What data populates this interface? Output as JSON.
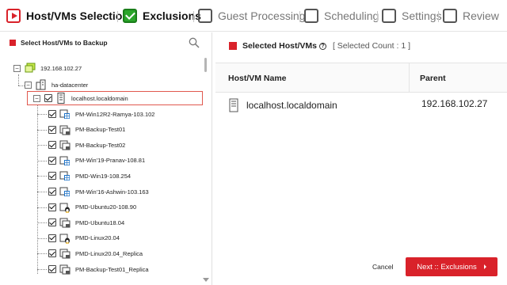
{
  "wizard": {
    "steps": [
      {
        "label": "Host/VMs Selection",
        "state": "active"
      },
      {
        "label": "Exclusions",
        "state": "done"
      },
      {
        "label": "Guest Processing",
        "state": "pending"
      },
      {
        "label": "Scheduling",
        "state": "pending"
      },
      {
        "label": "Settings",
        "state": "pending"
      },
      {
        "label": "Review",
        "state": "pending"
      }
    ]
  },
  "left_panel": {
    "title": "Select Host/VMs to Backup",
    "tree": {
      "root": {
        "label": "192.168.102.27",
        "icon": "host-cluster-icon"
      },
      "datacenter": {
        "label": "ha-datacenter",
        "icon": "datacenter-icon"
      },
      "host": {
        "label": "localhost.localdomain",
        "icon": "server-icon"
      },
      "vms": [
        {
          "label": "PM-Win12R2-Ramya-103.102",
          "icon": "windows-vm-icon"
        },
        {
          "label": "PM-Backup-Test01",
          "icon": "vm-icon"
        },
        {
          "label": "PM-Backup-Test02",
          "icon": "vm-icon"
        },
        {
          "label": "PM-Win'19-Pranav-108.81",
          "icon": "windows-vm-icon"
        },
        {
          "label": "PMD-Win19-108.254",
          "icon": "windows-vm-icon"
        },
        {
          "label": "PM-Win'16-Ashwin-103.163",
          "icon": "windows-vm-icon"
        },
        {
          "label": "PMD-Ubuntu20-108.90",
          "icon": "linux-vm-icon"
        },
        {
          "label": "PMD-Ubuntu18.04",
          "icon": "vm-icon"
        },
        {
          "label": "PMD-Linux20.04",
          "icon": "linux-vm-icon"
        },
        {
          "label": "PMD-Linux20.04_Replica",
          "icon": "vm-icon"
        },
        {
          "label": "PM-Backup-Test01_Replica",
          "icon": "vm-icon"
        }
      ]
    }
  },
  "right_panel": {
    "title": "Selected Host/VMs",
    "count_text": "[ Selected Count : 1 ]",
    "columns": [
      "Host/VM Name",
      "Parent"
    ],
    "rows": [
      {
        "name": "localhost.localdomain",
        "parent": "192.168.102.27"
      }
    ]
  },
  "footer": {
    "cancel_label": "Cancel",
    "next_label": "Next :: Exclusions"
  },
  "colors": {
    "accent": "#d9222a",
    "done": "#2aa52a"
  }
}
